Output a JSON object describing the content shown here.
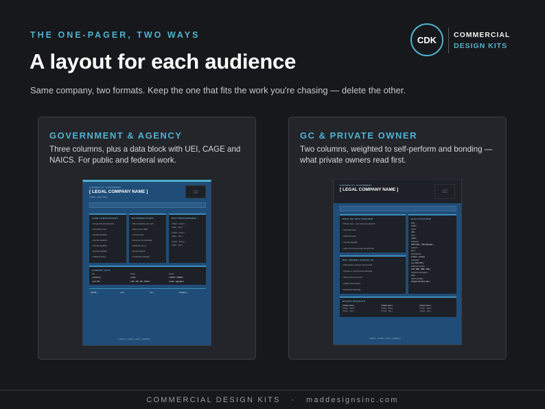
{
  "header": {
    "eyebrow": "THE ONE-PAGER, TWO WAYS",
    "title": "A layout for each audience",
    "subtitle": "Same company, two formats. Keep the one that fits the work you're chasing — delete the other."
  },
  "brand": {
    "mark": "CDK",
    "line1": "COMMERCIAL",
    "line2": "DESIGN KITS",
    "accent": "#4fb3cf"
  },
  "cards": {
    "government": {
      "title": "GOVERNMENT & AGENCY",
      "description": "Three columns, plus a data block with UEI, CAGE and NAICS. For public and federal work.",
      "preview": {
        "kicker": "CAPABILITY STATEMENT",
        "company": "[ LEGAL COMPANY NAME ]",
        "columns": [
          "CORE COMPETENCIES",
          "DIFFERENTIATORS",
          "PAST PERFORMANCE"
        ],
        "data_block": "COMPANY DATA",
        "data_fields": [
          "UEI",
          "CAGE",
          "NAICS"
        ],
        "footer_fields": [
          "[ DUNS ]",
          "[ CO ]",
          "[ Lic ]",
          "[ Regions ]"
        ]
      }
    },
    "private": {
      "title": "GC & PRIVATE OWNER",
      "description": "Two columns, weighted to self-perform and bonding — what private owners read first.",
      "preview": {
        "kicker": "CAPABILITY STATEMENT",
        "company": "[ LEGAL COMPANY NAME ]",
        "sections": [
          "WHAT WE SELF-PERFORM",
          "QUALIFICATIONS",
          "WHY OWNERS CHOOSE US",
          "RECENT PROJECTS"
        ],
        "projects": [
          "[ Project name ]",
          "[ Project name ]",
          "[ Project name ]"
        ]
      }
    }
  },
  "footer": {
    "text": "COMMERCIAL DESIGN KITS   ·   maddesignsinc.com"
  }
}
